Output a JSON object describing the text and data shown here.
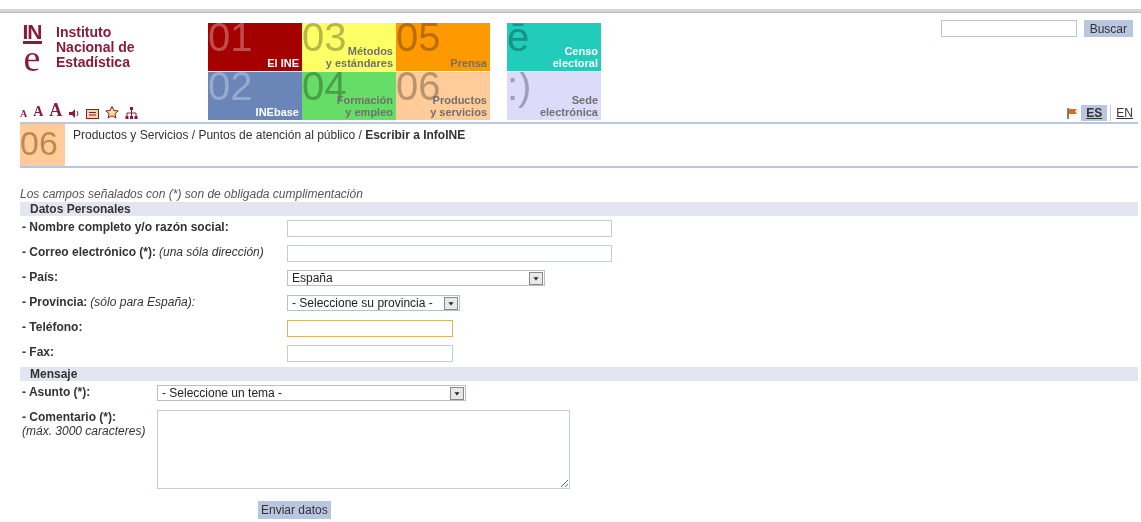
{
  "logo": {
    "mark_top": "IN",
    "mark_bottom": "e",
    "name": "Instituto\nNacional de\nEstadística"
  },
  "text_tools": {
    "font_sizes": [
      "A",
      "A",
      "A"
    ]
  },
  "tiles": [
    {
      "number": "01",
      "label": [
        "El INE"
      ],
      "color": "#a50000"
    },
    {
      "number": "03",
      "label": [
        "Métodos",
        "y estándares"
      ],
      "color": "#ffff66"
    },
    {
      "number": "05",
      "label": [
        "Prensa"
      ],
      "color": "#ff9900"
    },
    {
      "number": "02",
      "label": [
        "INEbase"
      ],
      "color": "#6a86b8"
    },
    {
      "number": "04",
      "label": [
        "Formación",
        "y empleo"
      ],
      "color": "#66dd66"
    },
    {
      "number": "06",
      "label": [
        "Productos",
        "y servicios"
      ],
      "color": "#ffcc99"
    }
  ],
  "side_tiles": [
    {
      "number": "ē",
      "label": [
        "Censo",
        "electoral"
      ],
      "color": "#22ccbb"
    },
    {
      "number": ":)",
      "label": [
        "Sede",
        "electrónica"
      ],
      "color": "#dcdcfa"
    }
  ],
  "search": {
    "button": "Buscar"
  },
  "languages": [
    {
      "code": "ES",
      "selected": true
    },
    {
      "code": "EN",
      "selected": false
    }
  ],
  "breadcrumb": {
    "number": "06",
    "path": "Productos y Servicios / Puntos de atención al público / **Escribir a InfoINE**"
  },
  "form": {
    "note": "Los campos señalados con (*) son de obligada cumplimentación",
    "sections": [
      {
        "title": "Datos Personales",
        "fields": [
          {
            "label": "- Nombre completo y/o razón social:",
            "kind": "text",
            "focused": false
          },
          {
            "label": "- Correo electrónico (*):",
            "note": "(una sóla dirección)",
            "kind": "text",
            "focused": false
          },
          {
            "label": "- País:",
            "kind": "select",
            "value": "España"
          },
          {
            "label": "- Provincia:",
            "note": "(sólo para España):",
            "kind": "select",
            "value": "- Seleccione su provincia -"
          },
          {
            "label": "- Teléfono:",
            "kind": "text",
            "focused": true
          },
          {
            "label": "- Fax:",
            "kind": "text",
            "focused": false
          }
        ]
      },
      {
        "title": "Mensaje",
        "fields": [
          {
            "label": "- Asunto (*):",
            "kind": "select",
            "value": "- Seleccione un tema -"
          },
          {
            "label": "- Comentario (*):",
            "note": "(máx. 3000 caracteres)",
            "kind": "textarea"
          }
        ]
      }
    ],
    "submit": "Enviar datos"
  }
}
